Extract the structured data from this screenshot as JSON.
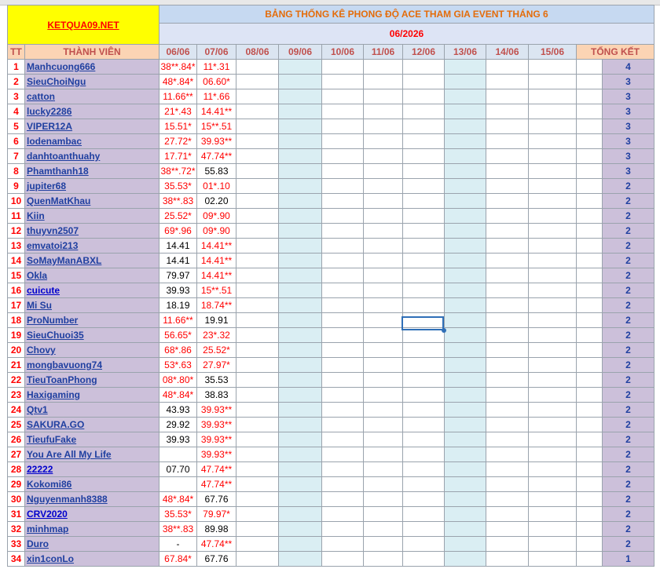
{
  "header": {
    "logo": "KETQUA09.NET",
    "subtitle": "BẢNG THỐNG KÊ PHONG ĐỘ ACE THAM GIA EVENT THÁNG 6",
    "month": "06/2026",
    "tt_label": "TT",
    "member_label": "THÀNH VIÊN",
    "total_label": "TỔNG KẾT",
    "dates": [
      "06/06",
      "07/06",
      "08/06",
      "09/06",
      "10/06",
      "11/06",
      "12/06",
      "13/06",
      "14/06",
      "15/06"
    ]
  },
  "rows": [
    {
      "tt": "1",
      "name": "Manhcuong666",
      "d1": "38**.84*",
      "d1red": true,
      "d2": "11*.31",
      "d2red": true,
      "total": "4"
    },
    {
      "tt": "2",
      "name": "SieuChoiNgu",
      "d1": "48*.84*",
      "d1red": true,
      "d2": "06.60*",
      "d2red": true,
      "total": "3"
    },
    {
      "tt": "3",
      "name": "catton",
      "d1": "11.66**",
      "d1red": true,
      "d2": "11*.66",
      "d2red": true,
      "total": "3"
    },
    {
      "tt": "4",
      "name": "lucky2286",
      "d1": "21*.43",
      "d1red": true,
      "d2": "14.41**",
      "d2red": true,
      "total": "3"
    },
    {
      "tt": "5",
      "name": "VIPER12A",
      "d1": "15.51*",
      "d1red": true,
      "d2": "15**.51",
      "d2red": true,
      "total": "3"
    },
    {
      "tt": "6",
      "name": "lodenambac",
      "d1": "27.72*",
      "d1red": true,
      "d2": "39.93**",
      "d2red": true,
      "total": "3"
    },
    {
      "tt": "7",
      "name": "danhtoanthuahy",
      "d1": "17.71*",
      "d1red": true,
      "d2": "47.74**",
      "d2red": true,
      "total": "3"
    },
    {
      "tt": "8",
      "name": "Phamthanh18",
      "d1": "38**.72*",
      "d1red": true,
      "d2": "55.83",
      "d2red": false,
      "total": "3"
    },
    {
      "tt": "9",
      "name": "jupiter68",
      "d1": "35.53*",
      "d1red": true,
      "d2": "01*.10",
      "d2red": true,
      "total": "2"
    },
    {
      "tt": "10",
      "name": "QuenMatKhau",
      "d1": "38**.83",
      "d1red": true,
      "d2": "02.20",
      "d2red": false,
      "total": "2"
    },
    {
      "tt": "11",
      "name": "Kiin",
      "d1": "25.52*",
      "d1red": true,
      "d2": "09*.90",
      "d2red": true,
      "total": "2"
    },
    {
      "tt": "12",
      "name": "thuyvn2507",
      "d1": "69*.96",
      "d1red": true,
      "d2": "09*.90",
      "d2red": true,
      "total": "2"
    },
    {
      "tt": "13",
      "name": "emvatoi213",
      "d1": "14.41",
      "d1red": false,
      "d2": "14.41**",
      "d2red": true,
      "total": "2"
    },
    {
      "tt": "14",
      "name": "SoMayManABXL",
      "d1": "14.41",
      "d1red": false,
      "d2": "14.41**",
      "d2red": true,
      "total": "2"
    },
    {
      "tt": "15",
      "name": "Okla",
      "d1": "79.97",
      "d1red": false,
      "d2": "14.41**",
      "d2red": true,
      "total": "2"
    },
    {
      "tt": "16",
      "name": "cuicute",
      "d1": "39.93",
      "d1red": false,
      "d2": "15**.51",
      "d2red": true,
      "total": "2",
      "strong": true
    },
    {
      "tt": "17",
      "name": "Mi Su",
      "d1": "18.19",
      "d1red": false,
      "d2": "18.74**",
      "d2red": true,
      "total": "2"
    },
    {
      "tt": "18",
      "name": "ProNumber",
      "d1": "11.66**",
      "d1red": true,
      "d2": "19.91",
      "d2red": false,
      "total": "2"
    },
    {
      "tt": "19",
      "name": "SieuChuoi35",
      "d1": "56.65*",
      "d1red": true,
      "d2": "23*.32",
      "d2red": true,
      "total": "2"
    },
    {
      "tt": "20",
      "name": "Chovy",
      "d1": "68*.86",
      "d1red": true,
      "d2": "25.52*",
      "d2red": true,
      "total": "2"
    },
    {
      "tt": "21",
      "name": "mongbavuong74",
      "d1": "53*.63",
      "d1red": true,
      "d2": "27.97*",
      "d2red": true,
      "total": "2"
    },
    {
      "tt": "22",
      "name": "TieuToanPhong",
      "d1": "08*.80*",
      "d1red": true,
      "d2": "35.53",
      "d2red": false,
      "total": "2"
    },
    {
      "tt": "23",
      "name": "Haxigaming",
      "d1": "48*.84*",
      "d1red": true,
      "d2": "38.83",
      "d2red": false,
      "total": "2"
    },
    {
      "tt": "24",
      "name": "Qtv1",
      "d1": "43.93",
      "d1red": false,
      "d2": "39.93**",
      "d2red": true,
      "total": "2"
    },
    {
      "tt": "25",
      "name": "SAKURA.GO",
      "d1": "29.92",
      "d1red": false,
      "d2": "39.93**",
      "d2red": true,
      "total": "2"
    },
    {
      "tt": "26",
      "name": "TieufuFake",
      "d1": "39.93",
      "d1red": false,
      "d2": "39.93**",
      "d2red": true,
      "total": "2"
    },
    {
      "tt": "27",
      "name": "You Are All My Life",
      "d1": "",
      "d1red": false,
      "d2": "39.93**",
      "d2red": true,
      "total": "2"
    },
    {
      "tt": "28",
      "name": "22222",
      "d1": "07.70",
      "d1red": false,
      "d2": "47.74**",
      "d2red": true,
      "total": "2",
      "strong": true
    },
    {
      "tt": "29",
      "name": "Kokomi86",
      "d1": "",
      "d1red": false,
      "d2": "47.74**",
      "d2red": true,
      "total": "2"
    },
    {
      "tt": "30",
      "name": "Nguyenmanh8388",
      "d1": "48*.84*",
      "d1red": true,
      "d2": "67.76",
      "d2red": false,
      "total": "2"
    },
    {
      "tt": "31",
      "name": "CRV2020",
      "d1": "35.53*",
      "d1red": true,
      "d2": "79.97*",
      "d2red": true,
      "total": "2",
      "strong": true
    },
    {
      "tt": "32",
      "name": "minhmap",
      "d1": "38**.83",
      "d1red": true,
      "d2": "89.98",
      "d2red": false,
      "total": "2"
    },
    {
      "tt": "33",
      "name": "Duro",
      "d1": "-",
      "d1red": false,
      "d2": "47.74**",
      "d2red": true,
      "total": "2"
    },
    {
      "tt": "34",
      "name": "xin1conLo",
      "d1": "67.84*",
      "d1red": true,
      "d2": "67.76",
      "d2red": false,
      "total": "1"
    }
  ]
}
